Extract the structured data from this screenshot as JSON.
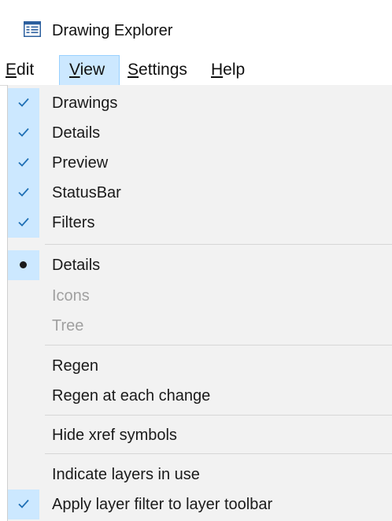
{
  "window": {
    "title": "Drawing Explorer",
    "icon": "explorer-window-icon"
  },
  "menubar": {
    "items": [
      {
        "label": "Edit",
        "mnemonic": "E",
        "rest": "dit"
      },
      {
        "label": "View",
        "mnemonic": "V",
        "rest": "iew",
        "open": true
      },
      {
        "label": "Settings",
        "mnemonic": "S",
        "rest": "ettings"
      },
      {
        "label": "Help",
        "mnemonic": "H",
        "rest": "elp"
      }
    ]
  },
  "view_menu": {
    "panes": [
      {
        "label": "Drawings",
        "checked": true
      },
      {
        "label": "Details",
        "checked": true
      },
      {
        "label": "Preview",
        "checked": true
      },
      {
        "label": "StatusBar",
        "checked": true
      },
      {
        "label": "Filters",
        "checked": true
      }
    ],
    "view_mode": [
      {
        "label": "Details",
        "selected": true,
        "enabled": true
      },
      {
        "label": "Icons",
        "selected": false,
        "enabled": false
      },
      {
        "label": "Tree",
        "selected": false,
        "enabled": false
      }
    ],
    "regen": [
      {
        "label": "Regen"
      },
      {
        "label": "Regen at each change"
      }
    ],
    "xref": [
      {
        "label": "Hide xref symbols"
      }
    ],
    "layers": [
      {
        "label": "Indicate layers in use",
        "checked": false
      },
      {
        "label": "Apply layer filter to layer toolbar",
        "checked": true
      }
    ]
  },
  "colors": {
    "highlight": "#cce8ff",
    "highlight_border": "#99d1ff",
    "check": "#1f6fb5",
    "menu_bg": "#f2f2f2",
    "disabled_text": "#a0a0a0"
  }
}
